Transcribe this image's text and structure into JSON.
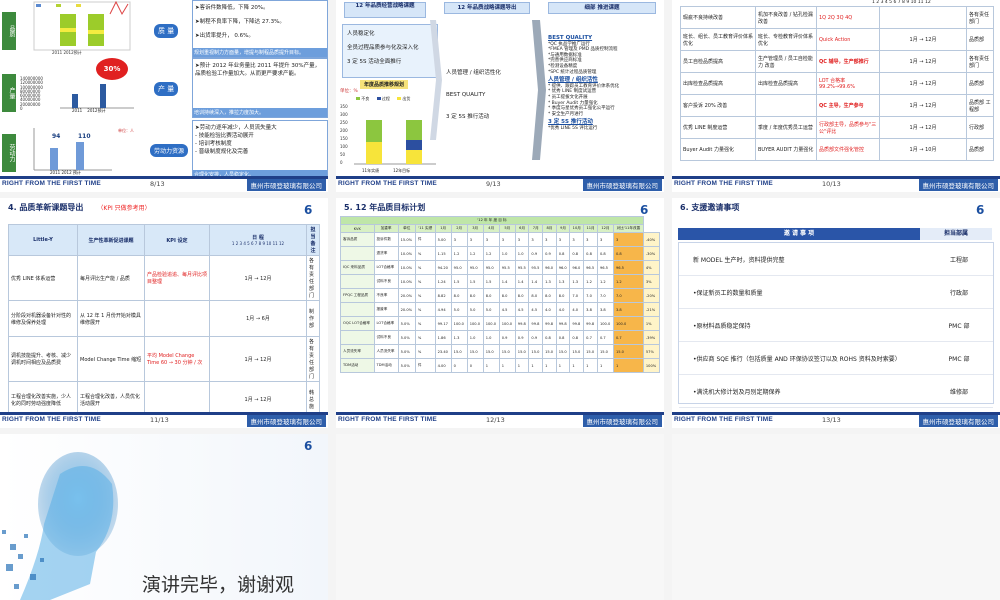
{
  "footer": {
    "slogan": "RIGHT FROM THE FIRST TIME",
    "company": "惠州市硕登玻璃有限公司"
  },
  "logo": {
    "text": "6"
  },
  "s1": {
    "labels": {
      "quality": "品质",
      "production": "产量",
      "labor": "劳动力"
    },
    "chart_top_caption": "2011  2012预计",
    "ticks": [
      "140000000",
      "120000000",
      "100000000",
      "80000000",
      "60000000",
      "40000000",
      "20000000",
      "0"
    ],
    "bar_years": [
      "2011",
      "2012预计"
    ],
    "burst": "30%",
    "labor_values": [
      "94",
      "110"
    ],
    "labor_caption": "2011   2012 预计",
    "labor_unit": "单位：人",
    "btn_quality": "质 量",
    "btn_production": "产 量",
    "btn_labor": "劳动力资源",
    "q_lines": [
      "➤客诉件数降低，下降 20%。",
      "➤制程不良率下降，下降达 27.3%。",
      "➤出货率提升， 0.6%。"
    ],
    "q_banner": "规划重视制力方面量，增提与制程品质提升目标。",
    "p_lines": [
      "➤预计 2012 年业务量比 2011 年提升 30%产量，品质检验工作量加大。从而更严要求产能。"
    ],
    "p_banner": "培训持续深入，推拉力度加大。",
    "l_lines": [
      "➤劳动力逐年减少，人员流失量大",
      "  - 技能检验比赛活动展开",
      "  - 培训考核制度",
      "  - 晋级制度规化及完善"
    ],
    "l_banner": "合理化安排，人员稳定化。",
    "page": "8/13"
  },
  "s2": {
    "col_heads": [
      "12 年品质经营战略课题",
      "12 年品质战略课题导出",
      "细部 推进课题"
    ],
    "left_items": [
      "人员稳定化",
      "全员过程品质参与化及深入化",
      "3 定 5S 活动全面推行"
    ],
    "chart_title": "年度品质推移规划",
    "chart_unit": "单位：%",
    "legend": [
      "不良",
      "过程",
      "出货"
    ],
    "bar_labels": [
      "11年实绩",
      "12年目标"
    ],
    "mid_items": [
      "人员管理 / 组织活性化",
      "BEST QUALITY",
      "3 定 5S 推行活动"
    ],
    "r1_title": "BEST QUALITY",
    "r1_items": [
      "*QC 执品学推广运行",
      "*FMEA 管理及 PMD 品质控制流程",
      "*与通用数据标准",
      "*完善供应商标准",
      "*检测设备精度",
      "*SPC 统计过程品质管理"
    ],
    "r2_title": "人员管理 / 组织活性",
    "r2_items": [
      "* 提供、跟踪员工教育评价体系优化",
      "* 优秀 LINE 制度试运营",
      "* 员工提拔文化开展",
      "* Buyer Audit 力量强化",
      "* 季度与星优秀员工强化公平运行",
      "* 安全生产月进行"
    ],
    "r3_title": "3 定 5S 推行活动",
    "r3_items": [
      "*优秀 LINE 5S 评比运行"
    ],
    "page": "9/13"
  },
  "s3": {
    "ticks": "1 2 3 4 5 6 7 8 9 10 11 12",
    "rows": [
      {
        "task": "瑕疵不良持续改善",
        "detail": "机加不良改善 / 钻孔检漏改善",
        "kpi": "1Q 2Q 3Q 4Q",
        "sched": "",
        "owner": "各有责任部门"
      },
      {
        "task": "班长、组长、员工教育评价体系优化",
        "detail": "班长、专检教育评价体系优化",
        "kpi": "Quick Action",
        "sched": "1月 → 12月",
        "owner": "品质部"
      },
      {
        "task": "员工自检品质提高",
        "detail": "生产管理员 / 员工自检能力 改善",
        "kpi": "QC 辅导，生产部推行",
        "sched": "1月 → 12月",
        "owner": "各有责任部门"
      },
      {
        "task": "出库检查品质提高",
        "detail": "出库检查品质提高",
        "kpi": "LOT 合格率 99.2%→99.6%",
        "sched": "1月 → 12月",
        "owner": "品质部"
      },
      {
        "task": "客户投诉 20% 改善",
        "detail": "",
        "kpi": "QC 主导，生产参与",
        "sched": "1月 → 12月",
        "owner": "品质部 工程部"
      },
      {
        "task": "优秀 LINE 制度运营",
        "detail": "季度 / 年度优秀员工运营",
        "kpi": "行政部主导，品质参与\"三公\"评比",
        "sched": "1月 → 12月",
        "owner": "行政部"
      },
      {
        "task": "Buyer Audit 力量强化",
        "detail": "BUYER AUDIT 力量强化",
        "kpi": "品质部文件强化管控",
        "sched": "1月 → 10月",
        "owner": "品质部"
      }
    ],
    "page": "10/13"
  },
  "s4": {
    "title": "4. 品质革新课题导出",
    "note": "（KPI 只做参考用）",
    "heads": [
      "Little-Y",
      "生产性革新促进课题",
      "KPI 设定",
      "日 程",
      "担 当 备 注"
    ],
    "ticks": "1 2 3 4 5 6 7 8 9 10 11 12",
    "rows": [
      {
        "y": "优秀 LINE 体系运营",
        "task": "每月评比生产能 / 品质",
        "kpi": "产品检验追追、每月评比项目整理",
        "sched": "1月 → 12月",
        "owner": "各有责任部门"
      },
      {
        "y": "分阶段对机器设备针对性的维修及保养处理",
        "task": "从 12 年 1 月份开始对模具维修展开",
        "kpi": "",
        "sched": "1月 → 6月",
        "owner": "制作部"
      },
      {
        "y": "调机技能提升、考核、减少调机时间相应及品质费",
        "task": "Model Change Time 缩短",
        "kpi": "平均 Model Change Time 60 → 30 分钟 / 次",
        "sched": "1月 → 12月",
        "owner": "各有责任部门"
      },
      {
        "y": "工程合理化改善实施，少人化的同时劳动强度降低",
        "task": "工程合理化改善，人员优化活动展开",
        "kpi": "",
        "sched": "1月 → 12月",
        "owner": "韩总施"
      }
    ],
    "page": "11/13"
  },
  "s5": {
    "title": "5.  12 年品质目标计划",
    "top_head": "'12 年 年 度 目 标",
    "col_heads": [
      "KVK",
      "加重率",
      "单位",
      "'11 实绩",
      "1月",
      "2月",
      "3月",
      "4月",
      "5月",
      "6月",
      "7月",
      "8月",
      "9月",
      "10月",
      "11月",
      "12月",
      "对比'11年改善"
    ],
    "rows": [
      {
        "g": "客诉品质",
        "n": "投诉件数",
        "w": "15.0%",
        "u": "件",
        "a": "5.00",
        "m": [
          "3",
          "3",
          "3",
          "3",
          "3",
          "3",
          "3",
          "3",
          "3",
          "3",
          "3",
          "3"
        ],
        "r": "-40%"
      },
      {
        "g": "",
        "n": "退货率",
        "w": "10.0%",
        "u": "%",
        "a": "1.15",
        "m": [
          "1.2",
          "1.2",
          "1.2",
          "1.0",
          "1.0",
          "0.9",
          "0.9",
          "0.8",
          "0.8",
          "0.8",
          "0.8",
          "0.8"
        ],
        "r": "-30%"
      },
      {
        "g": "IQC 来料品质",
        "n": "LOT合格率",
        "w": "10.0%",
        "u": "%",
        "a": "94.20",
        "m": [
          "95.0",
          "95.0",
          "95.0",
          "95.5",
          "95.5",
          "95.5",
          "96.0",
          "96.0",
          "96.0",
          "96.5",
          "96.5",
          "96.5"
        ],
        "r": "4%"
      },
      {
        "g": "",
        "n": "试料不良",
        "w": "10.0%",
        "u": "%",
        "a": "1.24",
        "m": [
          "1.5",
          "1.5",
          "1.5",
          "1.4",
          "1.4",
          "1.4",
          "1.3",
          "1.3",
          "1.3",
          "1.2",
          "1.2",
          "1.2"
        ],
        "r": "3%"
      },
      {
        "g": "FPQC 工程品质",
        "n": "不良率",
        "w": "20.0%",
        "u": "%",
        "a": "8.82",
        "m": [
          "8.0",
          "8.0",
          "8.0",
          "8.0",
          "8.0",
          "8.0",
          "8.0",
          "8.0",
          "7.0",
          "7.0",
          "7.0",
          "7.0"
        ],
        "r": "-20%"
      },
      {
        "g": "",
        "n": "报废率",
        "w": "20.0%",
        "u": "%",
        "a": "4.94",
        "m": [
          "5.0",
          "5.0",
          "5.0",
          "4.5",
          "4.5",
          "4.5",
          "4.0",
          "4.0",
          "4.0",
          "3.8",
          "3.8",
          "3.8"
        ],
        "r": "-21%"
      },
      {
        "g": "OQC LOT合格率",
        "n": "LOT合格率",
        "w": "5.0%",
        "u": "%",
        "a": "99.17",
        "m": [
          "100.0",
          "100.0",
          "100.0",
          "100.0",
          "99.8",
          "99.8",
          "99.8",
          "99.8",
          "99.8",
          "99.8",
          "100.0",
          "100.0"
        ],
        "r": "1%"
      },
      {
        "g": "",
        "n": "试料不良",
        "w": "5.0%",
        "u": "%",
        "a": "1.86",
        "m": [
          "1.3",
          "1.0",
          "1.0",
          "0.9",
          "0.9",
          "0.9",
          "0.8",
          "0.8",
          "0.8",
          "0.7",
          "0.7",
          "0.7"
        ],
        "r": "-39%"
      },
      {
        "g": "人员流失率",
        "n": "人员流失率",
        "w": "5.0%",
        "u": "%",
        "a": "23.40",
        "m": [
          "15.0",
          "15.0",
          "15.0",
          "15.0",
          "15.0",
          "15.0",
          "15.0",
          "15.0",
          "15.0",
          "15.0",
          "15.0",
          "15.0"
        ],
        "r": "57%"
      },
      {
        "g": "TDM活动",
        "n": "TDM活动",
        "w": "5.0%",
        "u": "件",
        "a": "4.00",
        "m": [
          "0",
          "0",
          "1",
          "1",
          "1",
          "1",
          "1",
          "1",
          "1",
          "1",
          "1",
          "1"
        ],
        "r": "100%"
      }
    ],
    "page": "12/13"
  },
  "s6": {
    "title": "6. 支援邀请事项",
    "head_items": "邀  请  事  项",
    "head_dept": "担当部属",
    "items": [
      {
        "text": "新 MODEL 生产时，资料提供完整",
        "dept": "工程部"
      },
      {
        "text": "•保证新员工的数量和质量",
        "dept": "行政部"
      },
      {
        "text": "•原材料品质稳定保持",
        "dept": "PMC 部"
      },
      {
        "text": "•供应商 SQE 推行（包括质量 AND 环保协议签订以及 ROHS 资料及时索要）",
        "dept": "PMC 部"
      },
      {
        "text": "•满洗机大修计划及月别定期保养",
        "dept": "维修部"
      }
    ],
    "page": "13/13"
  },
  "s7": {
    "thanks": "演讲完毕，谢谢观"
  }
}
